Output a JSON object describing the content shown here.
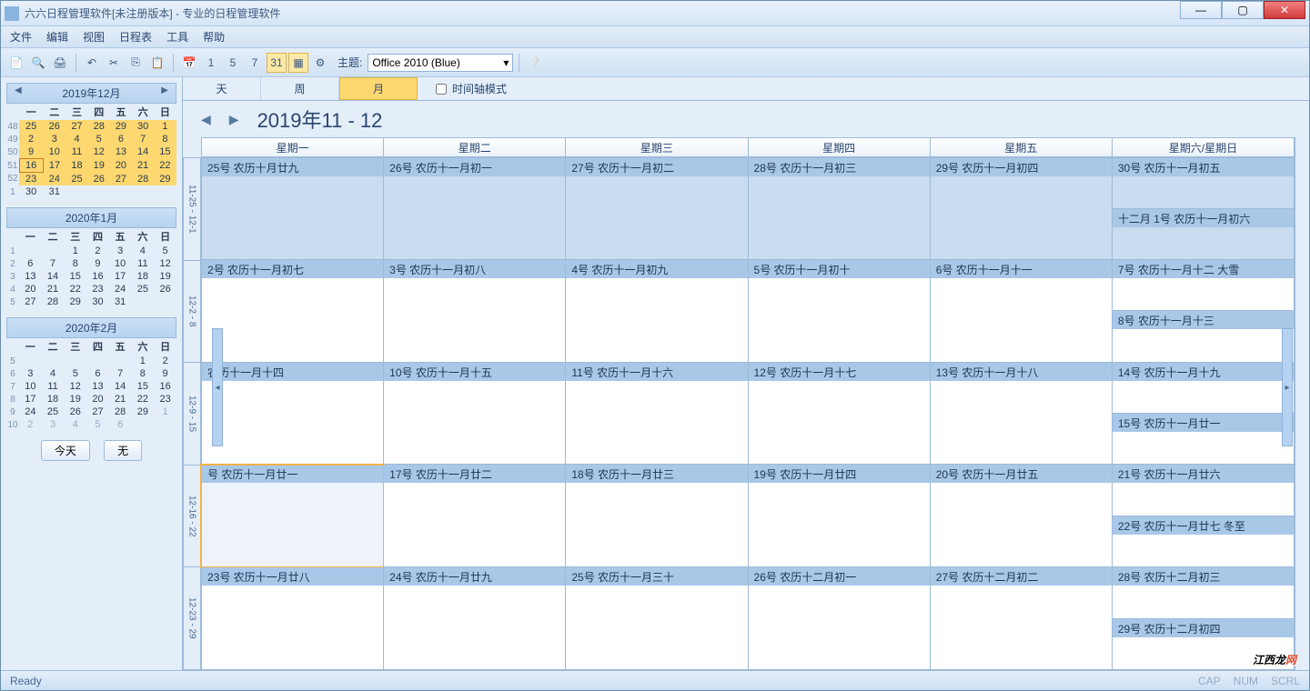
{
  "window": {
    "title": "六六日程管理软件[未注册版本] - 专业的日程管理软件"
  },
  "menus": [
    "文件",
    "编辑",
    "视图",
    "日程表",
    "工具",
    "帮助"
  ],
  "theme": {
    "label": "主题:",
    "value": "Office 2010 (Blue)"
  },
  "viewtabs": {
    "day": "天",
    "week": "周",
    "month": "月",
    "timeline": "时间轴模式"
  },
  "nav": {
    "range": "2019年11 - 12"
  },
  "dayheaders": [
    "星期一",
    "星期二",
    "星期三",
    "星期四",
    "星期五",
    "星期六/星期日"
  ],
  "gutter": [
    "11-25 - 12-1",
    "12-2 - 8",
    "12-9 - 15",
    "12-16 - 22",
    "12-23 - 29"
  ],
  "weeks": [
    {
      "mon": "25号 农历十月廿九",
      "tue": "26号 农历十一月初一",
      "wed": "27号 农历十一月初二",
      "thu": "28号 农历十一月初三",
      "fri": "29号 农历十一月初四",
      "sat": "30号 农历十一月初五",
      "sun": "十二月 1号 农历十一月初六",
      "dim": true
    },
    {
      "mon": "2号 农历十一月初七",
      "tue": "3号 农历十一月初八",
      "wed": "4号 农历十一月初九",
      "thu": "5号 农历十一月初十",
      "fri": "6号 农历十一月十一",
      "sat": "7号 农历十一月十二 大雪",
      "sun": "8号 农历十一月十三"
    },
    {
      "mon": "农历十一月十四",
      "tue": "10号 农历十一月十五",
      "wed": "11号 农历十一月十六",
      "thu": "12号 农历十一月十七",
      "fri": "13号 农历十一月十八",
      "sat": "14号 农历十一月十九",
      "sun": "15号 农历十一月廿一"
    },
    {
      "mon": "号 农历十一月廿一",
      "tue": "17号 农历十一月廿二",
      "wed": "18号 农历十一月廿三",
      "thu": "19号 农历十一月廿四",
      "fri": "20号 农历十一月廿五",
      "sat": "21号 农历十一月廿六",
      "sun": "22号 农历十一月廿七 冬至",
      "today": true
    },
    {
      "mon": "23号 农历十一月廿八",
      "tue": "24号 农历十一月廿九",
      "wed": "25号 农历十一月三十",
      "thu": "26号 农历十二月初一",
      "fri": "27号 农历十二月初二",
      "sat": "28号 农历十二月初三",
      "sun": "29号 农历十二月初四"
    }
  ],
  "mini": [
    {
      "title": "2019年12月",
      "wd": [
        "一",
        "二",
        "三",
        "四",
        "五",
        "六",
        "日"
      ],
      "rows": [
        {
          "w": "48",
          "d": [
            "25",
            "26",
            "27",
            "28",
            "29",
            "30",
            "1"
          ],
          "hl": true
        },
        {
          "w": "49",
          "d": [
            "2",
            "3",
            "4",
            "5",
            "6",
            "7",
            "8"
          ],
          "hl": true
        },
        {
          "w": "50",
          "d": [
            "9",
            "10",
            "11",
            "12",
            "13",
            "14",
            "15"
          ],
          "hl": true
        },
        {
          "w": "51",
          "d": [
            "16",
            "17",
            "18",
            "19",
            "20",
            "21",
            "22"
          ],
          "hl": true,
          "today": 0
        },
        {
          "w": "52",
          "d": [
            "23",
            "24",
            "25",
            "26",
            "27",
            "28",
            "29"
          ],
          "hl": true
        },
        {
          "w": "1",
          "d": [
            "30",
            "31",
            "",
            "",
            "",
            "",
            ""
          ]
        }
      ]
    },
    {
      "title": "2020年1月",
      "wd": [
        "一",
        "二",
        "三",
        "四",
        "五",
        "六",
        "日"
      ],
      "rows": [
        {
          "w": "1",
          "d": [
            "",
            "",
            "1",
            "2",
            "3",
            "4",
            "5"
          ]
        },
        {
          "w": "2",
          "d": [
            "6",
            "7",
            "8",
            "9",
            "10",
            "11",
            "12"
          ]
        },
        {
          "w": "3",
          "d": [
            "13",
            "14",
            "15",
            "16",
            "17",
            "18",
            "19"
          ]
        },
        {
          "w": "4",
          "d": [
            "20",
            "21",
            "22",
            "23",
            "24",
            "25",
            "26"
          ]
        },
        {
          "w": "5",
          "d": [
            "27",
            "28",
            "29",
            "30",
            "31",
            "",
            ""
          ]
        }
      ]
    },
    {
      "title": "2020年2月",
      "wd": [
        "一",
        "二",
        "三",
        "四",
        "五",
        "六",
        "日"
      ],
      "rows": [
        {
          "w": "5",
          "d": [
            "",
            "",
            "",
            "",
            "",
            "1",
            "2"
          ]
        },
        {
          "w": "6",
          "d": [
            "3",
            "4",
            "5",
            "6",
            "7",
            "8",
            "9"
          ]
        },
        {
          "w": "7",
          "d": [
            "10",
            "11",
            "12",
            "13",
            "14",
            "15",
            "16"
          ]
        },
        {
          "w": "8",
          "d": [
            "17",
            "18",
            "19",
            "20",
            "21",
            "22",
            "23"
          ]
        },
        {
          "w": "9",
          "d": [
            "24",
            "25",
            "26",
            "27",
            "28",
            "29",
            "1"
          ],
          "dimlast": true
        },
        {
          "w": "10",
          "d": [
            "2",
            "3",
            "4",
            "5",
            "6",
            "",
            ""
          ],
          "dim": true
        }
      ]
    }
  ],
  "sidebtns": {
    "today": "今天",
    "none": "无"
  },
  "status": {
    "ready": "Ready",
    "caps": "CAP",
    "num": "NUM",
    "scrl": "SCRL"
  },
  "watermark": {
    "a": "江西龙",
    "b": "网"
  }
}
